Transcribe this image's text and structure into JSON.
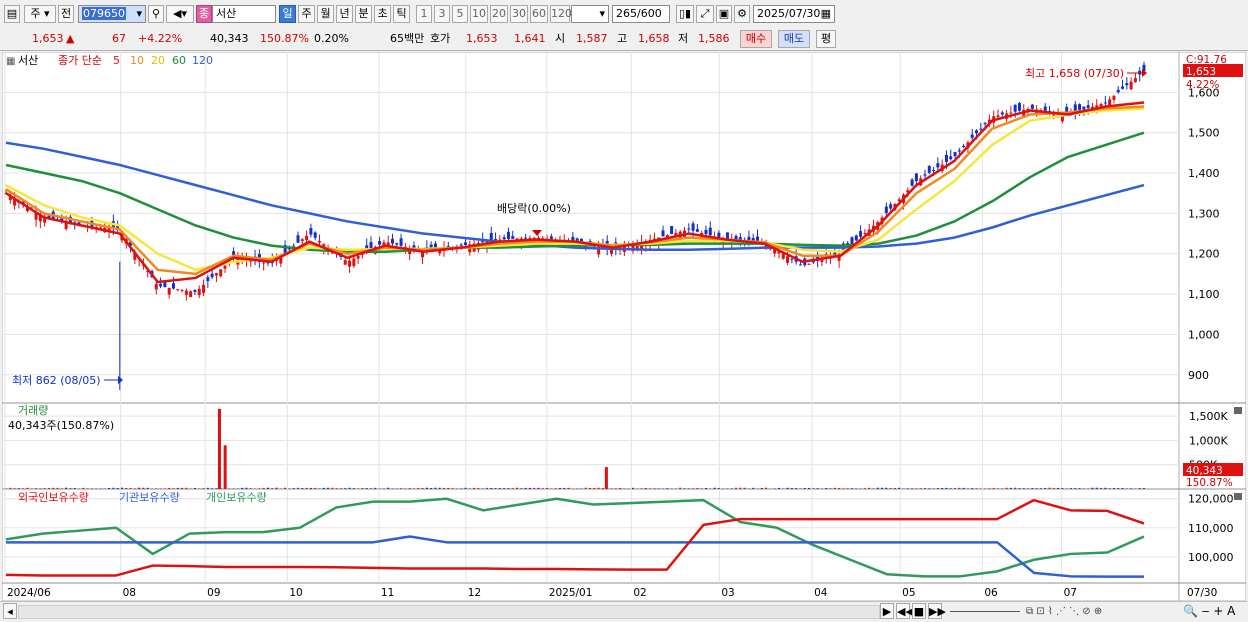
{
  "toolbar": {
    "period_prefix": "주",
    "prefix2": "전",
    "code": "079650",
    "name": "서산",
    "name_badge": "종",
    "periods": [
      "일",
      "주",
      "월",
      "년",
      "분",
      "초",
      "틱"
    ],
    "selected_period": "일",
    "intervals": [
      "1",
      "3",
      "5",
      "10",
      "20",
      "30",
      "60",
      "120"
    ],
    "count_value": "265",
    "count_total": "/600",
    "date": "2025/07/30"
  },
  "quote": {
    "price": "1,653",
    "arrow": "▲",
    "change": "67",
    "change_pct": "+4.22%",
    "volume": "40,343",
    "vol_ratio": "150.87%",
    "turnover": "0.20%",
    "amount": "65백만",
    "ask_label": "호가",
    "ask": "1,653",
    "bid": "1,641",
    "open_label": "시",
    "open": "1,587",
    "high_label": "고",
    "high": "1,658",
    "low_label": "저",
    "low": "1,586",
    "buy": "매수",
    "sell": "매도",
    "eval": "평"
  },
  "colors": {
    "price_red": "#d40000",
    "ma5": "#e01010",
    "ma10": "#f08a20",
    "ma20": "#f5e83a",
    "ma60": "#1f8f3a",
    "ma120": "#2f5fd8",
    "foreign": "#e01010",
    "inst": "#2f5fd8",
    "retail": "#2f9a5a"
  },
  "chart_data": [
    {
      "type": "line",
      "title": "서산",
      "legend": [
        "종가 단순",
        "5",
        "10",
        "20",
        "60",
        "120"
      ],
      "legend_position": "top-left",
      "x_labels": [
        "2024/06",
        "08",
        "09",
        "10",
        "11",
        "12",
        "2025/01",
        "02",
        "03",
        "04",
        "05",
        "06",
        "07"
      ],
      "x_end_label": "07/30",
      "y_ticks": [
        900,
        1000,
        1100,
        1200,
        1300,
        1400,
        1500,
        1600
      ],
      "y_tick_labels": [
        "900",
        "1,000",
        "1,100",
        "1,200",
        "1,300",
        "1,400",
        "1,500",
        "1,600"
      ],
      "ylim": [
        830,
        1700
      ],
      "x_anchor_values": [
        1350,
        1290,
        1270,
        1260,
        1120,
        1105,
        1190,
        1175,
        1250,
        1180,
        1230,
        1205,
        1220,
        1235,
        1240,
        1230,
        1210,
        1235,
        1260,
        1235,
        1230,
        1170,
        1200,
        1280,
        1380,
        1440,
        1540,
        1560,
        1545,
        1575,
        1653
      ],
      "series": [
        {
          "name": "5",
          "values": [
            1350,
            1290,
            1270,
            1250,
            1130,
            1140,
            1190,
            1180,
            1230,
            1190,
            1220,
            1205,
            1215,
            1230,
            1235,
            1230,
            1215,
            1230,
            1250,
            1235,
            1225,
            1180,
            1195,
            1270,
            1370,
            1430,
            1530,
            1555,
            1545,
            1565,
            1575
          ]
        },
        {
          "name": "10",
          "values": [
            1360,
            1300,
            1280,
            1260,
            1160,
            1150,
            1195,
            1185,
            1225,
            1200,
            1215,
            1210,
            1215,
            1225,
            1230,
            1230,
            1220,
            1228,
            1240,
            1235,
            1228,
            1195,
            1195,
            1255,
            1350,
            1410,
            1510,
            1545,
            1550,
            1560,
            1565
          ]
        },
        {
          "name": "20",
          "values": [
            1370,
            1320,
            1290,
            1270,
            1200,
            1160,
            1180,
            1190,
            1215,
            1210,
            1212,
            1212,
            1215,
            1220,
            1225,
            1225,
            1222,
            1225,
            1232,
            1232,
            1228,
            1210,
            1205,
            1235,
            1310,
            1380,
            1470,
            1530,
            1545,
            1555,
            1560
          ]
        },
        {
          "name": "60",
          "values": [
            1420,
            1400,
            1380,
            1350,
            1310,
            1270,
            1240,
            1220,
            1210,
            1205,
            1205,
            1210,
            1215,
            1215,
            1218,
            1220,
            1222,
            1222,
            1225,
            1225,
            1225,
            1222,
            1220,
            1225,
            1245,
            1280,
            1330,
            1390,
            1440,
            1470,
            1500
          ]
        },
        {
          "name": "120",
          "values": [
            1475,
            1460,
            1440,
            1420,
            1395,
            1370,
            1345,
            1320,
            1300,
            1280,
            1265,
            1250,
            1240,
            1230,
            1222,
            1215,
            1212,
            1210,
            1210,
            1212,
            1215,
            1215,
            1215,
            1218,
            1225,
            1240,
            1265,
            1295,
            1320,
            1345,
            1370
          ]
        }
      ],
      "annotations": [
        {
          "text": "최고 1,658 (07/30)",
          "value": 1658
        },
        {
          "text": "최저 862 (08/05)",
          "value": 862
        },
        {
          "text": "배당락(0.00%)"
        }
      ],
      "right_labels": {
        "c_label": "C:91.76",
        "last": "1,653",
        "pct": "4.22%"
      }
    },
    {
      "type": "bar",
      "title": "거래량",
      "subtitle": "40,343주(150.87%)",
      "y_ticks": [
        500,
        1000,
        1500
      ],
      "y_tick_labels": [
        "500K",
        "1,000K",
        "1,500K"
      ],
      "ylim": [
        0,
        1750
      ],
      "spikes": [
        {
          "position": 0.17,
          "value": 1650
        },
        {
          "position": 0.175,
          "value": 900
        },
        {
          "position": 0.51,
          "value": 450
        }
      ],
      "baseline_value": 18,
      "last_value_label": "40,343",
      "last_pct_label": "150.87%"
    },
    {
      "type": "line",
      "legend": [
        "외국인보유수량",
        "기관보유수량",
        "개인보유수량"
      ],
      "y_ticks": [
        100000,
        110000,
        120000
      ],
      "y_tick_labels": [
        "100,000",
        "110,000",
        "120,000"
      ],
      "ylim": [
        91000,
        123000
      ],
      "series": [
        {
          "name": "외국인보유수량",
          "values": [
            93800,
            93600,
            93600,
            93600,
            97000,
            96800,
            96500,
            96500,
            96500,
            96400,
            96200,
            96000,
            96000,
            96000,
            95800,
            95800,
            95700,
            95600,
            95600,
            111000,
            113000,
            113000,
            113000,
            113000,
            113000,
            113000,
            113000,
            113000,
            119500,
            116000,
            115800,
            111500
          ]
        },
        {
          "name": "기관보유수량",
          "values": [
            105000,
            105000,
            105000,
            105000,
            105000,
            105000,
            105000,
            105000,
            105000,
            105000,
            105000,
            107000,
            105000,
            105000,
            105000,
            105000,
            105000,
            105000,
            105000,
            105000,
            105000,
            105000,
            105000,
            105000,
            105000,
            105000,
            105000,
            105000,
            94500,
            93300,
            93200,
            93200
          ]
        },
        {
          "name": "개인보유수량",
          "values": [
            106000,
            108000,
            109000,
            110000,
            101000,
            108000,
            108500,
            108500,
            110000,
            117000,
            119000,
            119000,
            120000,
            116000,
            118000,
            120000,
            118000,
            118500,
            119000,
            119500,
            112000,
            110000,
            104000,
            99000,
            94000,
            93300,
            93300,
            95000,
            99000,
            101000,
            101500,
            107000
          ]
        }
      ]
    }
  ]
}
